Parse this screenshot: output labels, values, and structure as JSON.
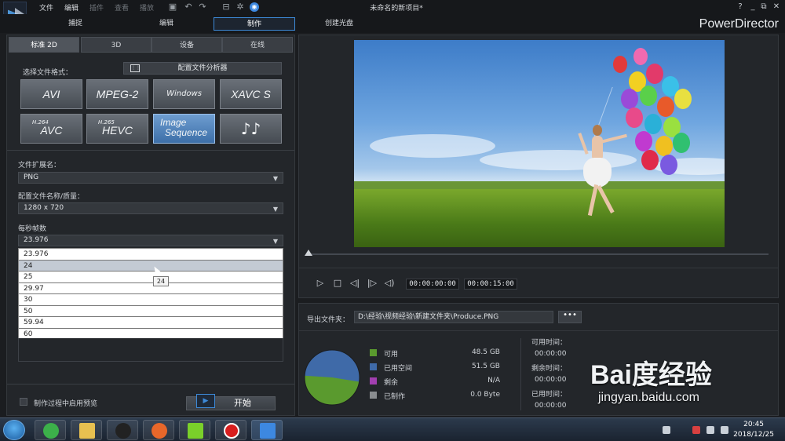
{
  "titlebar": {
    "menus": [
      "文件",
      "编辑",
      "插件",
      "查看",
      "播放"
    ],
    "doc_title": "未命名的新项目*"
  },
  "modes": [
    "捕捉",
    "编辑",
    "制作",
    "创建光盘"
  ],
  "brand": "PowerDirector",
  "left": {
    "subtabs": [
      "标准 2D",
      "3D",
      "设备",
      "在线"
    ],
    "format_label": "选择文件格式：",
    "profile_button": "配置文件分析器",
    "formats": [
      {
        "label": "AVI"
      },
      {
        "label": "MPEG-2"
      },
      {
        "label": "Windows Media"
      },
      {
        "label": "XAVC S"
      },
      {
        "sup": "H.264",
        "label": "AVC"
      },
      {
        "sup": "H.265",
        "label": "HEVC"
      },
      {
        "label1": "Image",
        "label2": "Sequence"
      },
      {
        "label": "♪♪"
      }
    ],
    "ext_label": "文件扩展名：",
    "ext_value": "PNG",
    "profile_label": "配置文件名称/质量：",
    "profile_value": "1280 x 720",
    "fps_label": "每秒帧数",
    "fps_value": "23.976",
    "fps_options": [
      "23.976",
      "24",
      "25",
      "29.97",
      "30",
      "50",
      "59.94",
      "60"
    ],
    "tooltip": "24",
    "preview_label": "制作过程中启用预览",
    "start_button": "开始"
  },
  "preview": {
    "time_current": "00:00:00:00",
    "time_total": "00:00:15:00"
  },
  "output": {
    "folder_label": "导出文件夹：",
    "folder_path": "D:\\经验\\视频经验\\新建文件夹\\Produce.PNG",
    "browse": "•••",
    "legend": [
      {
        "label": "可用",
        "value": "48.5  GB",
        "color": "#5a9a2e"
      },
      {
        "label": "已用空间",
        "value": "51.5  GB",
        "color": "#3f6aa8"
      },
      {
        "label": "剩余",
        "value": "N/A",
        "color": "#a23fb0"
      },
      {
        "label": "已制作",
        "value": "0.0  Byte",
        "color": "#8a8d90"
      }
    ],
    "avail_time_label": "可用时间：",
    "avail_time": "00:00:00",
    "remain_time_label": "剩余时间：",
    "remain_time": "00:00:00",
    "used_time_label": "已用时间：",
    "used_time": "00:00:00"
  },
  "watermark": {
    "main": "Bai度经验",
    "sub": "jingyan.baidu.com"
  },
  "taskbar": {
    "time": "20:45",
    "date": "2018/12/25"
  }
}
